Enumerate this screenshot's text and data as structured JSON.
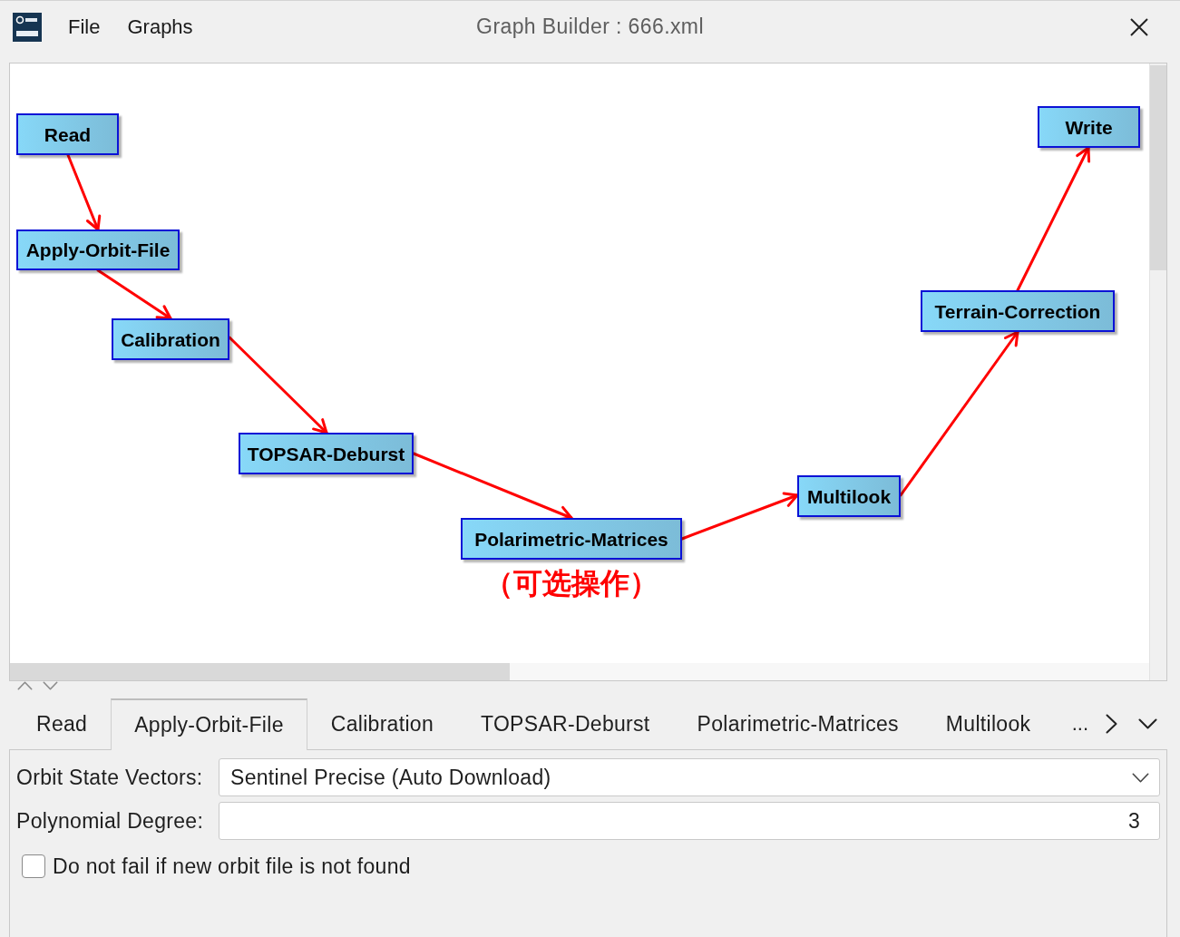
{
  "window": {
    "title": "Graph Builder : 666.xml"
  },
  "menu": [
    {
      "label": "File"
    },
    {
      "label": "Graphs"
    }
  ],
  "graph": {
    "nodes": [
      {
        "label": "Read"
      },
      {
        "label": "Apply-Orbit-File"
      },
      {
        "label": "Calibration"
      },
      {
        "label": "TOPSAR-Deburst"
      },
      {
        "label": "Polarimetric-Matrices",
        "note": "（可选操作）"
      },
      {
        "label": "Multilook"
      },
      {
        "label": "Terrain-Correction"
      },
      {
        "label": "Write"
      }
    ]
  },
  "tabs": [
    {
      "label": "Read",
      "selected": false
    },
    {
      "label": "Apply-Orbit-File",
      "selected": true
    },
    {
      "label": "Calibration",
      "selected": false
    },
    {
      "label": "TOPSAR-Deburst",
      "selected": false
    },
    {
      "label": "Polarimetric-Matrices",
      "selected": false
    },
    {
      "label": "Multilook",
      "selected": false
    }
  ],
  "tab_overflow": "...",
  "parameters": [
    {
      "kind": "dropdown",
      "label": "Orbit State Vectors:",
      "value": "Sentinel Precise (Auto Download)"
    },
    {
      "kind": "number",
      "label": "Polynomial Degree:",
      "value": "3"
    },
    {
      "kind": "checkbox",
      "label": "Do not fail if new orbit file is not found",
      "checked": false
    }
  ]
}
